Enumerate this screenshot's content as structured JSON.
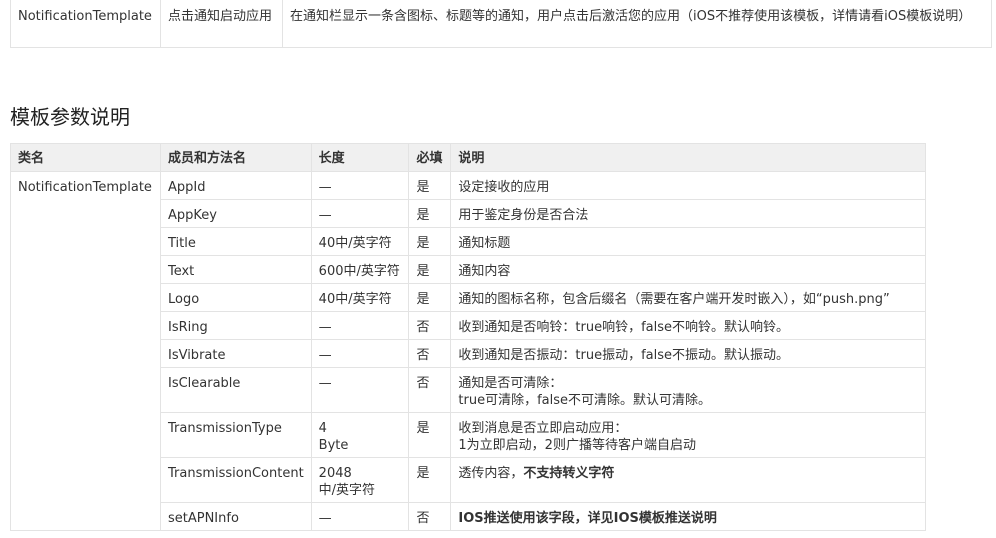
{
  "top_table": {
    "row": {
      "class_name": "NotificationTemplate",
      "function": "点击通知启动应用",
      "description": "在通知栏显示一条含图标、标题等的通知，用户点击后激活您的应用（iOS不推荐使用该模板，详情请看iOS模板说明）"
    }
  },
  "section": {
    "title": "模板参数说明"
  },
  "params_table": {
    "headers": [
      "类名",
      "成员和方法名",
      "长度",
      "必填",
      "说明"
    ],
    "class_name": "NotificationTemplate",
    "rows": [
      {
        "member": "AppId",
        "length": "—",
        "required": "是",
        "desc": "设定接收的应用"
      },
      {
        "member": "AppKey",
        "length": "—",
        "required": "是",
        "desc": "用于鉴定身份是否合法"
      },
      {
        "member": "Title",
        "length": "40中/英字符",
        "required": "是",
        "desc": "通知标题"
      },
      {
        "member": "Text",
        "length": "600中/英字符",
        "required": "是",
        "desc": "通知内容"
      },
      {
        "member": "Logo",
        "length": "40中/英字符",
        "required": "是",
        "desc": "通知的图标名称，包含后缀名（需要在客户端开发时嵌入），如“push.png”"
      },
      {
        "member": "IsRing",
        "length": "—",
        "required": "否",
        "desc": "收到通知是否响铃：true响铃，false不响铃。默认响铃。"
      },
      {
        "member": "IsVibrate",
        "length": "—",
        "required": "否",
        "desc": "收到通知是否振动：true振动，false不振动。默认振动。"
      },
      {
        "member": "IsClearable",
        "length": "—",
        "required": "否",
        "desc_line1": "通知是否可清除：",
        "desc_line2": "true可清除，false不可清除。默认可清除。"
      },
      {
        "member": "TransmissionType",
        "length_line1": "4",
        "length_line2": "Byte",
        "required": "是",
        "desc_line1": "收到消息是否立即启动应用：",
        "desc_line2": "1为立即启动，2则广播等待客户端自启动"
      },
      {
        "member": "TransmissionContent",
        "length_line1": "2048",
        "length_line2": "中/英字符",
        "required": "是",
        "desc_plain": "透传内容，",
        "desc_bold": "不支持转义字符"
      },
      {
        "member": "setAPNInfo",
        "length": "—",
        "required": "否",
        "desc_bold": "IOS推送使用该字段，详见IOS模板推送说明"
      }
    ]
  }
}
